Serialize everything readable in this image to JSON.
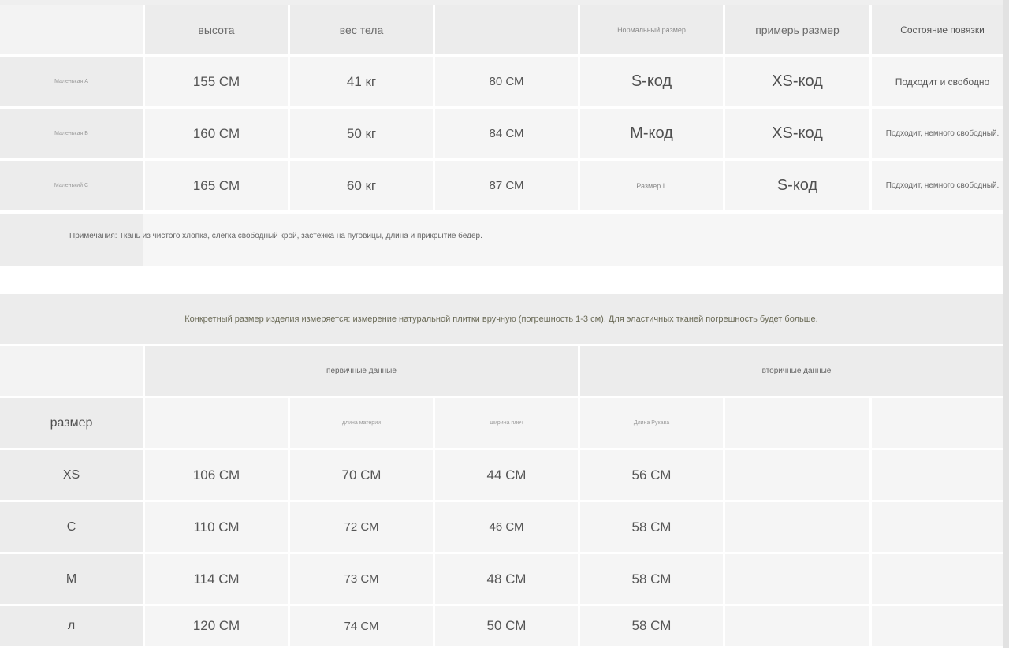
{
  "table1": {
    "headers": [
      "высота",
      "вес тела",
      "",
      "Нормальный размер",
      "примерь размер",
      "Состояние повязки"
    ],
    "rows": [
      {
        "model": "Маленькая А",
        "height": "155 СМ",
        "weight": "41 кг",
        "bust": "80 СМ",
        "normal": "S-код",
        "tried": "XS-код",
        "fit": "Подходит и свободно"
      },
      {
        "model": "Маленькая Б",
        "height": "160 СМ",
        "weight": "50 кг",
        "bust": "84 СМ",
        "normal": "М-код",
        "tried": "XS-код",
        "fit": "Подходит, немного свободный."
      },
      {
        "model": "Маленький С",
        "height": "165 СМ",
        "weight": "60 кг",
        "bust": "87 СМ",
        "normal": "Размер L",
        "tried": "S-код",
        "fit": "Подходит, немного свободный."
      }
    ],
    "note": "Примечания: Ткань из чистого хлопка, слегка свободный крой, застежка на пуговицы, длина и прикрытие бедер."
  },
  "banner": "Конкретный размер изделия измеряется: измерение натуральной плитки вручную (погрешность 1-3 см). Для эластичных тканей погрешность будет больше.",
  "table2": {
    "group_primary": "первичные данные",
    "group_secondary": "вторичные данные",
    "size_label": "размер",
    "col_headers": [
      "",
      "длина материи",
      "ширина плеч",
      "Длина Рукава"
    ],
    "rows": [
      {
        "size": "XS",
        "bust": "106 СМ",
        "length": "70 СМ",
        "shoulder": "44 СМ",
        "sleeve": "56 СМ"
      },
      {
        "size": "С",
        "bust": "110 СМ",
        "length": "72 СМ",
        "shoulder": "46 СМ",
        "sleeve": "58 СМ"
      },
      {
        "size": "M",
        "bust": "114 СМ",
        "length": "73 СМ",
        "shoulder": "48 СМ",
        "sleeve": "58 СМ"
      },
      {
        "size": "л",
        "bust": "120 СМ",
        "length": "74 СМ",
        "shoulder": "50 СМ",
        "sleeve": "58 СМ"
      }
    ]
  }
}
